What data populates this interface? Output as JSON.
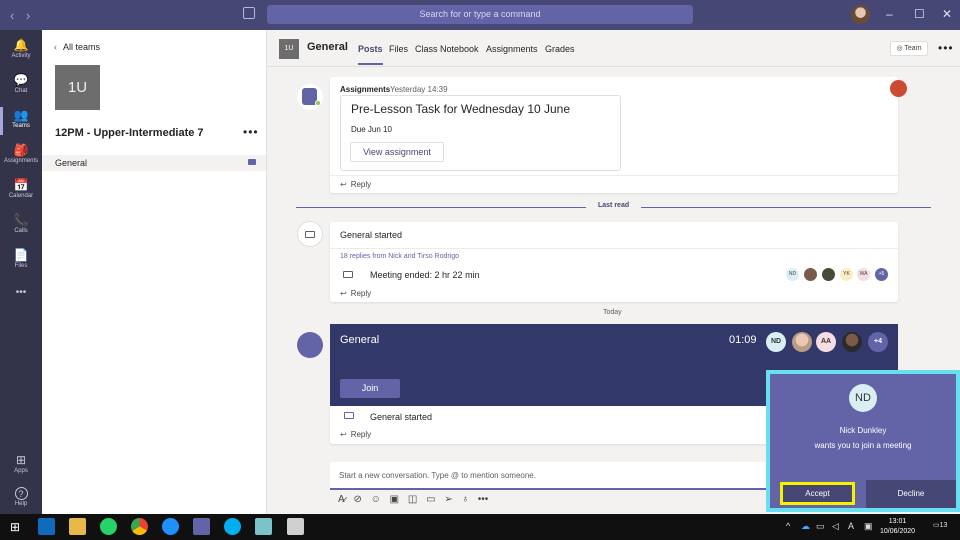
{
  "titlebar": {
    "search_placeholder": "Search for or type a command",
    "back_icon": "‹",
    "forward_icon": "›",
    "minimize": "–",
    "maximize": "☐",
    "close": "✕"
  },
  "rail": {
    "items": [
      {
        "label": "Activity",
        "icon": "bell-icon",
        "glyph": "🔔"
      },
      {
        "label": "Chat",
        "icon": "chat-icon",
        "glyph": "💬"
      },
      {
        "label": "Teams",
        "icon": "teams-icon",
        "glyph": "👥"
      },
      {
        "label": "Assignments",
        "icon": "assignments-icon",
        "glyph": "🎒"
      },
      {
        "label": "Calendar",
        "icon": "calendar-icon",
        "glyph": "📅"
      },
      {
        "label": "Calls",
        "icon": "phone-icon",
        "glyph": "📞"
      },
      {
        "label": "Files",
        "icon": "file-icon",
        "glyph": "📄"
      },
      {
        "label": "•••",
        "icon": "more-icon",
        "glyph": ""
      }
    ],
    "bottom": [
      {
        "label": "Apps",
        "icon": "apps-icon",
        "glyph": "⊞"
      },
      {
        "label": "Help",
        "icon": "help-icon",
        "glyph": "?"
      }
    ],
    "active": "Teams"
  },
  "sidebar": {
    "back_label": "All teams",
    "team_tile": "1U",
    "team_name": "12PM - Upper-Intermediate 7",
    "more": "•••",
    "channel": "General"
  },
  "header": {
    "tile": "1U",
    "channel_name": "General",
    "tabs": [
      "Posts",
      "Files",
      "Class Notebook",
      "Assignments",
      "Grades"
    ],
    "active_tab": "Posts",
    "team_button": "Team",
    "more": "•••"
  },
  "assignment_post": {
    "author": "Assignments",
    "timestamp": "Yesterday 14:39",
    "card_title": "Pre-Lesson Task for Wednesday 10 June",
    "due": "Due Jun 10",
    "button": "View assignment",
    "reply": "Reply"
  },
  "last_read": "Last read",
  "meeting_post": {
    "title": "General started",
    "replies": "18 replies from Nick and Tirso Rodrigo",
    "ended": "Meeting ended: 2 hr 22 min",
    "participants": [
      "ND",
      "",
      "",
      "YK",
      "WA",
      "+5"
    ],
    "reply": "Reply"
  },
  "today": "Today",
  "live_meeting": {
    "title": "General",
    "timer": "01:09",
    "participants": [
      "ND",
      "",
      "AA",
      "",
      "+4"
    ],
    "join": "Join",
    "started": "General started",
    "reply": "Reply"
  },
  "compose": {
    "placeholder": "Start a new conversation. Type @ to mention someone."
  },
  "toast": {
    "initials": "ND",
    "name": "Nick Dunkley",
    "message": "wants you to join a meeting",
    "accept": "Accept",
    "decline": "Decline"
  },
  "taskbar": {
    "time": "13:01",
    "date": "10/06/2020",
    "notification_count": "13",
    "language": "A"
  },
  "colors": {
    "brand": "#6264a7",
    "titlebar": "#464775",
    "rail": "#33344a",
    "banner": "#33386b",
    "highlight": "#f5f200",
    "toast_outline": "#68dff0"
  }
}
